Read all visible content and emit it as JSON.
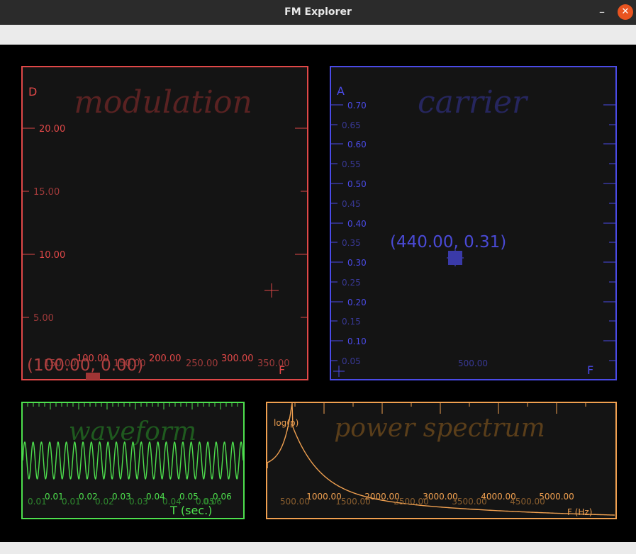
{
  "window": {
    "title": "FM Explorer",
    "minimize_glyph": "–",
    "close_glyph": "✕"
  },
  "panels": {
    "modulation": {
      "name": "modulation",
      "color": "#e04848",
      "y_axis_label": "D",
      "x_axis_label": "F",
      "y_ticks": [
        "20.00",
        "15.00",
        "10.00",
        "5.00"
      ],
      "x_ticks": [
        "150.00",
        "100.00",
        "150.00",
        "200.00",
        "250.00",
        "300.00",
        "350.00"
      ],
      "readout": "(100.00, 0.00)"
    },
    "carrier": {
      "name": "carrier",
      "color": "#4a4ae6",
      "y_axis_label": "A",
      "x_axis_label": "F",
      "y_ticks": [
        "0.70",
        "0.65",
        "0.60",
        "0.55",
        "0.50",
        "0.45",
        "0.40",
        "0.35",
        "0.30",
        "0.25",
        "0.20",
        "0.15",
        "0.10",
        "0.05"
      ],
      "x_ticks": [
        "500.00"
      ],
      "readout": "(440.00, 0.31)"
    },
    "waveform": {
      "name": "waveform",
      "color": "#4ee04e",
      "x_ticks_top": [
        "0.01",
        "0.02",
        "0.03",
        "0.04",
        "0.05",
        "0.06"
      ],
      "x_ticks_bottom": [
        "0.01",
        "0.01",
        "0.02",
        "0.03",
        "0.04",
        "0.05",
        "0.06"
      ],
      "x_axis_label": "T (sec.)"
    },
    "spectrum": {
      "name": "power spectrum",
      "color": "#f0a050",
      "y_axis_label": "log(p)",
      "x_axis_label": "F (Hz)",
      "x_ticks_top": [
        "1000.00",
        "2000.00",
        "3000.00",
        "4000.00",
        "5000.00"
      ],
      "x_ticks_bottom": [
        "500.00",
        "1500.00",
        "2500.00",
        "3500.00",
        "4500.00"
      ]
    }
  }
}
